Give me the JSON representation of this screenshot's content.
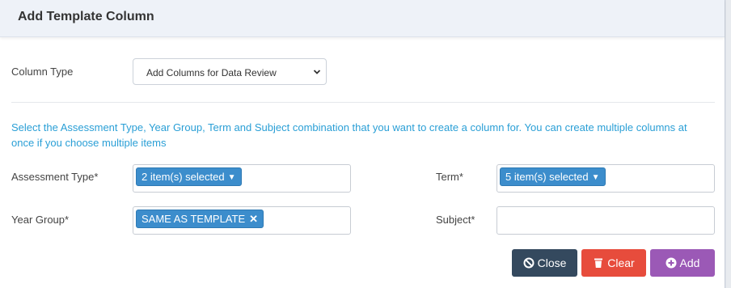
{
  "modal": {
    "title": "Add Template Column"
  },
  "column_type": {
    "label": "Column Type",
    "selected": "Add Columns for Data Review"
  },
  "info_text": "Select the Assessment Type, Year Group, Term and Subject combination that you want to create a column for. You can create multiple columns at once if you choose multiple items",
  "fields": {
    "assessment_type": {
      "label": "Assessment Type*",
      "tag": "2 item(s) selected"
    },
    "term": {
      "label": "Term*",
      "tag": "5 item(s) selected"
    },
    "year_group": {
      "label": "Year Group*",
      "tag": "SAME AS TEMPLATE"
    },
    "subject": {
      "label": "Subject*",
      "value": ""
    }
  },
  "buttons": {
    "close": "Close",
    "clear": "Clear",
    "add": "Add"
  },
  "colors": {
    "tag": "#3c8dcc",
    "close": "#34495e",
    "clear": "#e74c3c",
    "add": "#9b59b6",
    "info": "#2a9fd6"
  }
}
